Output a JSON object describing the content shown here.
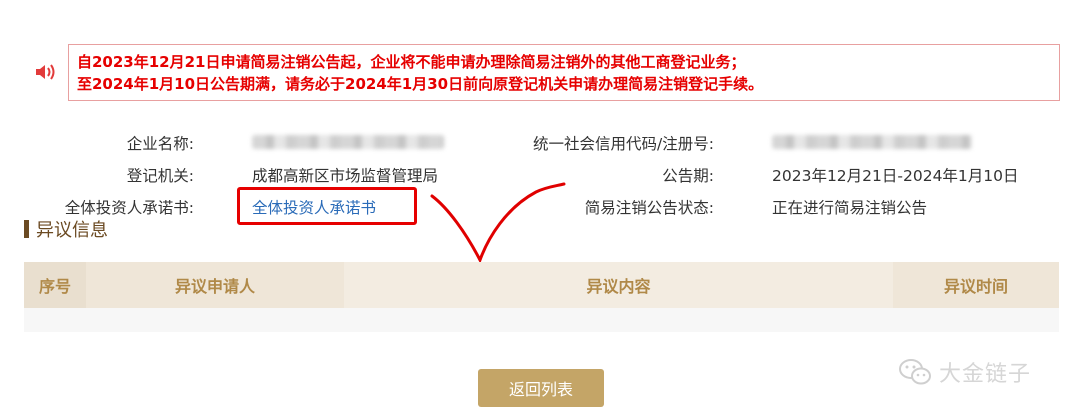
{
  "notice": {
    "line1": "自2023年12月21日申请简易注销公告起，企业将不能申请办理除简易注销外的其他工商登记业务；",
    "line2": "至2024年1月10日公告期满，请务必于2024年1月30日前向原登记机关申请办理简易注销登记手续。"
  },
  "info": {
    "company_name_label": "企业名称:",
    "registration_authority_label": "登记机关:",
    "registration_authority_value": "成都高新区市场监督管理局",
    "commitment_label": "全体投资人承诺书:",
    "commitment_link": "全体投资人承诺书",
    "credit_code_label": "统一社会信用代码/注册号:",
    "announcement_period_label": "公告期:",
    "announcement_period_value": "2023年12月21日-2024年1月10日",
    "status_label": "简易注销公告状态:",
    "status_value": "正在进行简易注销公告"
  },
  "objection": {
    "title": "异议信息",
    "columns": [
      "序号",
      "异议申请人",
      "异议内容",
      "异议时间"
    ],
    "rows": []
  },
  "back_button": "返回列表",
  "watermark": "大金链子",
  "colors": {
    "notice_red": "#e60000",
    "link_blue": "#2a6bb8",
    "header_gold": "#b08948",
    "button_gold": "#c4a567",
    "section_brown": "#6b4a22"
  }
}
